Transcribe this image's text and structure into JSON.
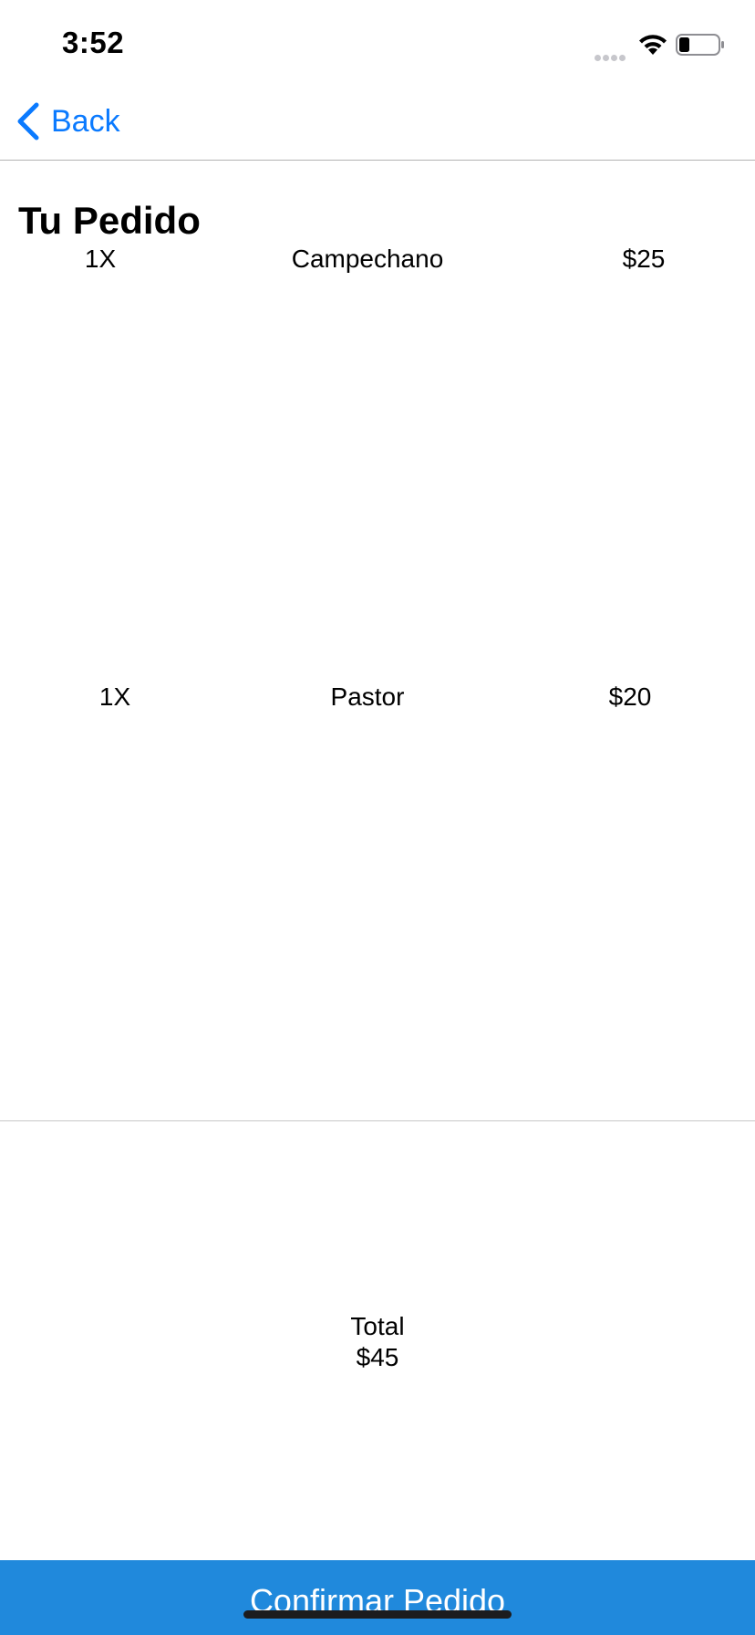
{
  "status_bar": {
    "time": "3:52",
    "icons": [
      "signal-dots-icon",
      "wifi-icon",
      "battery-icon"
    ]
  },
  "nav": {
    "back_label": "Back",
    "back_icon": "chevron-left-icon",
    "accent_color": "#0a7aff"
  },
  "page": {
    "title": "Tu Pedido"
  },
  "order": {
    "items": [
      {
        "qty": "1X",
        "name": "Campechano",
        "price": "$25"
      },
      {
        "qty": "1X",
        "name": "Pastor",
        "price": "$20"
      }
    ]
  },
  "total": {
    "label": "Total",
    "value": "$45"
  },
  "confirm": {
    "label": "Confirmar Pedido",
    "color": "#2089dc"
  }
}
